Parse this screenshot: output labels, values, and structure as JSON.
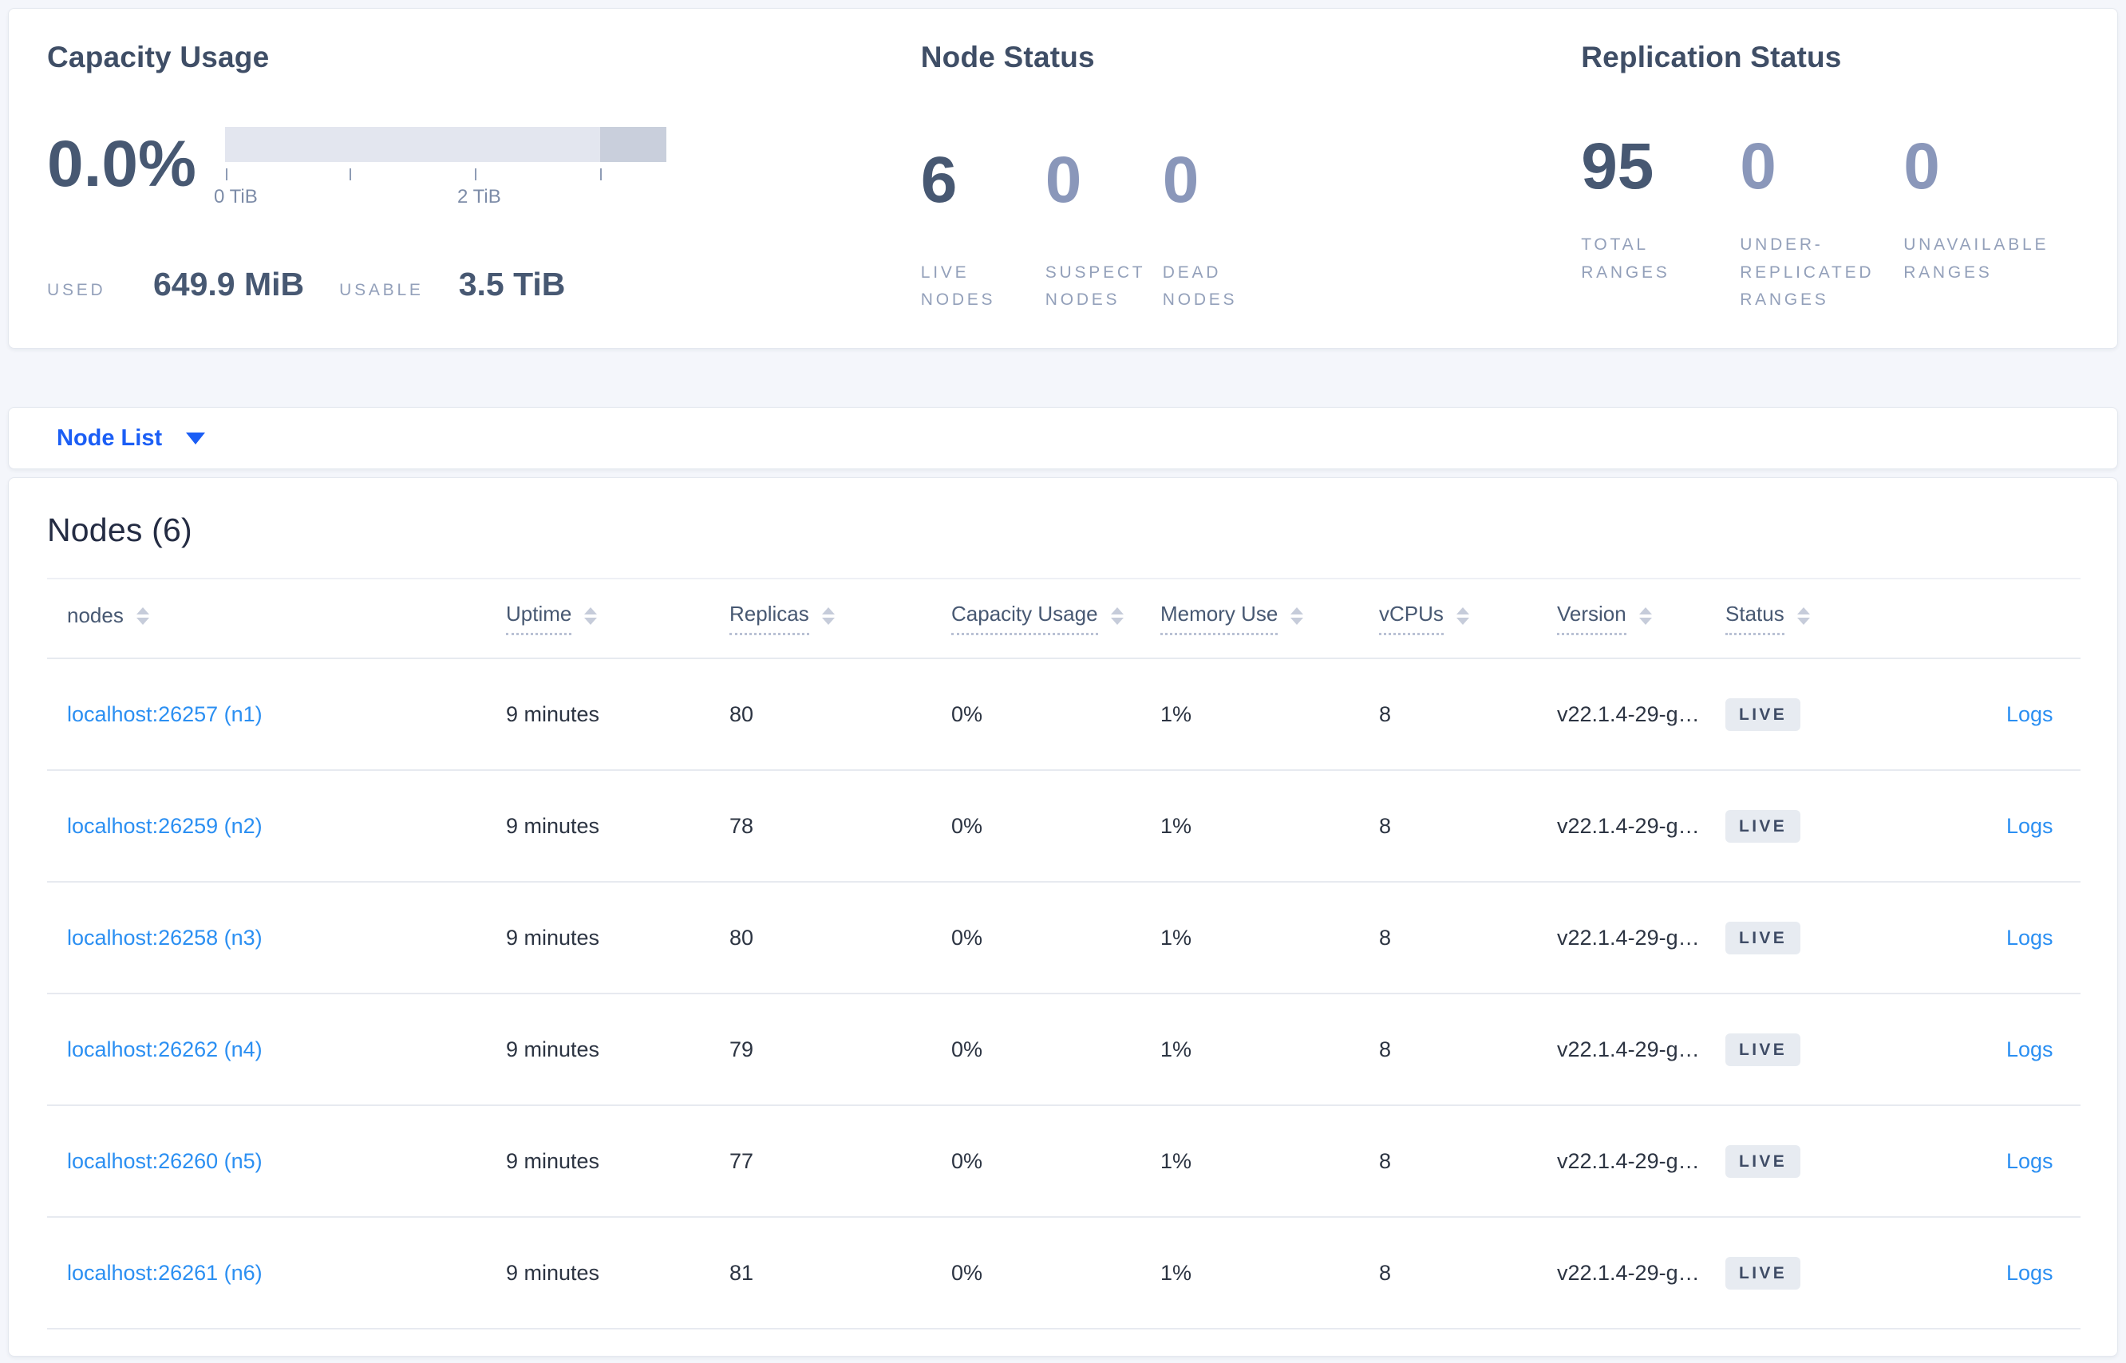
{
  "summary": {
    "capacity": {
      "title": "Capacity Usage",
      "percent": "0.0%",
      "tick_label_0": "0 TiB",
      "tick_label_2": "2 TiB",
      "used_label": "USED",
      "used_value": "649.9 MiB",
      "usable_label": "USABLE",
      "usable_value": "3.5 TiB",
      "used_fraction": 0.0,
      "bar_track_color": "#e3e6ef",
      "bar_reserved_color": "#c9cfdc"
    },
    "node_status": {
      "title": "Node Status",
      "stats": [
        {
          "value": "6",
          "label": "LIVE NODES",
          "emphasis": "strong"
        },
        {
          "value": "0",
          "label": "SUSPECT NODES",
          "emphasis": "muted"
        },
        {
          "value": "0",
          "label": "DEAD NODES",
          "emphasis": "muted"
        }
      ]
    },
    "replication_status": {
      "title": "Replication Status",
      "stats": [
        {
          "value": "95",
          "label": "TOTAL RANGES",
          "emphasis": "strong"
        },
        {
          "value": "0",
          "label": "UNDER-REPLICATED RANGES",
          "emphasis": "muted"
        },
        {
          "value": "0",
          "label": "UNAVAILABLE RANGES",
          "emphasis": "muted"
        }
      ]
    }
  },
  "view_selector": {
    "label": "Node List",
    "icon": "caret-down-icon",
    "accent_color": "#1b5ef5"
  },
  "nodes_table": {
    "title": "Nodes (6)",
    "columns": [
      {
        "label": "nodes",
        "dashed": false
      },
      {
        "label": "Uptime",
        "dashed": true
      },
      {
        "label": "Replicas",
        "dashed": true
      },
      {
        "label": "Capacity Usage",
        "dashed": true
      },
      {
        "label": "Memory Use",
        "dashed": true
      },
      {
        "label": "vCPUs",
        "dashed": true
      },
      {
        "label": "Version",
        "dashed": true
      },
      {
        "label": "Status",
        "dashed": true
      }
    ],
    "rows": [
      {
        "node": "localhost:26257 (n1)",
        "uptime": "9 minutes",
        "replicas": "80",
        "capacity_usage": "0%",
        "memory_use": "1%",
        "vcpus": "8",
        "version": "v22.1.4-29-g…",
        "status": "LIVE",
        "logs": "Logs"
      },
      {
        "node": "localhost:26259 (n2)",
        "uptime": "9 minutes",
        "replicas": "78",
        "capacity_usage": "0%",
        "memory_use": "1%",
        "vcpus": "8",
        "version": "v22.1.4-29-g…",
        "status": "LIVE",
        "logs": "Logs"
      },
      {
        "node": "localhost:26258 (n3)",
        "uptime": "9 minutes",
        "replicas": "80",
        "capacity_usage": "0%",
        "memory_use": "1%",
        "vcpus": "8",
        "version": "v22.1.4-29-g…",
        "status": "LIVE",
        "logs": "Logs"
      },
      {
        "node": "localhost:26262 (n4)",
        "uptime": "9 minutes",
        "replicas": "79",
        "capacity_usage": "0%",
        "memory_use": "1%",
        "vcpus": "8",
        "version": "v22.1.4-29-g…",
        "status": "LIVE",
        "logs": "Logs"
      },
      {
        "node": "localhost:26260 (n5)",
        "uptime": "9 minutes",
        "replicas": "77",
        "capacity_usage": "0%",
        "memory_use": "1%",
        "vcpus": "8",
        "version": "v22.1.4-29-g…",
        "status": "LIVE",
        "logs": "Logs"
      },
      {
        "node": "localhost:26261 (n6)",
        "uptime": "9 minutes",
        "replicas": "81",
        "capacity_usage": "0%",
        "memory_use": "1%",
        "vcpus": "8",
        "version": "v22.1.4-29-g…",
        "status": "LIVE",
        "logs": "Logs"
      }
    ],
    "link_color": "#2b8ff2"
  }
}
